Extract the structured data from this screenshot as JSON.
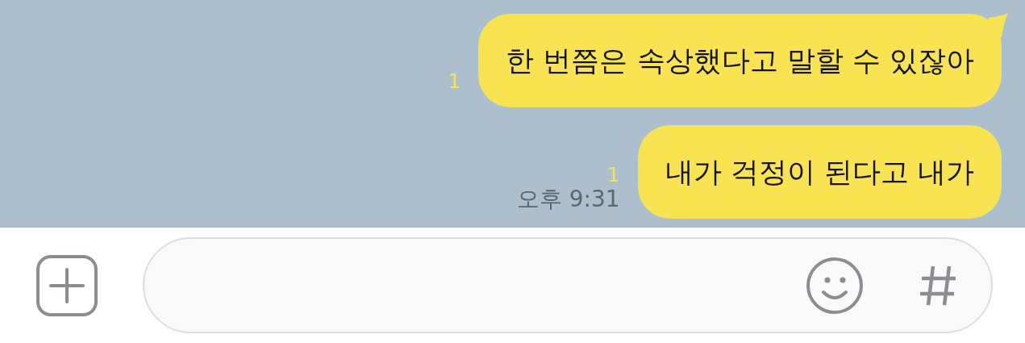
{
  "messages": [
    {
      "text": "한 번쯤은 속상했다고 말할 수 있잖아",
      "unread": "1",
      "tail": true
    },
    {
      "text": "내가 걱정이 된다고 내가",
      "unread": "1",
      "time": "오후 9:31",
      "tail": false
    }
  ]
}
